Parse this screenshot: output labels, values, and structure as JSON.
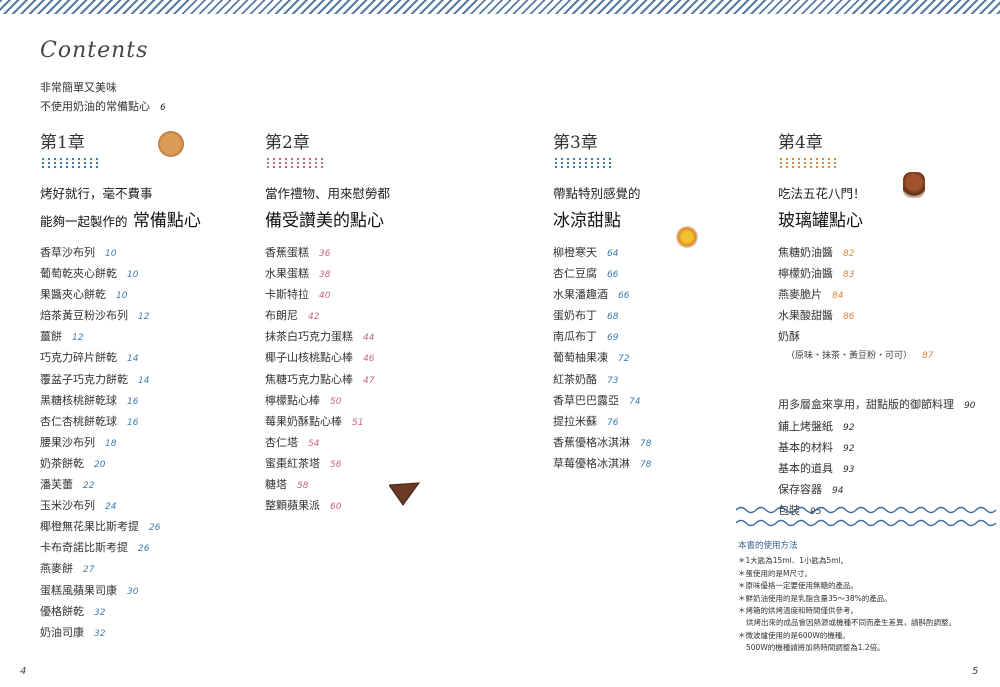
{
  "contents_title": "Contents",
  "intro": {
    "line1": "非常簡單又美味",
    "line2": "不使用奶油的常備點心",
    "page": "6"
  },
  "colors": {
    "blue": "#3e7bb0",
    "pink": "#c8648c",
    "orange": "#d98a3e",
    "wave": "#3f6e9e"
  },
  "chapters": [
    {
      "label": "第1章",
      "sub1": "烤好就行，毫不費事",
      "sub2a": "能夠一起製作的",
      "sub2b": "常備點心",
      "items": [
        {
          "t": "香草沙布列",
          "p": "10"
        },
        {
          "t": "葡萄乾夾心餅乾",
          "p": "10"
        },
        {
          "t": "果醬夾心餅乾",
          "p": "10"
        },
        {
          "t": "焙茶黃豆粉沙布列",
          "p": "12"
        },
        {
          "t": "薑餅",
          "p": "12"
        },
        {
          "t": "巧克力碎片餅乾",
          "p": "14"
        },
        {
          "t": "覆盆子巧克力餅乾",
          "p": "14"
        },
        {
          "t": "黑糖核桃餅乾球",
          "p": "16"
        },
        {
          "t": "杏仁杏桃餅乾球",
          "p": "16"
        },
        {
          "t": "腰果沙布列",
          "p": "18"
        },
        {
          "t": "奶茶餅乾",
          "p": "20"
        },
        {
          "t": "潘芙蕾",
          "p": "22"
        },
        {
          "t": "玉米沙布列",
          "p": "24"
        },
        {
          "t": "椰橙無花果比斯考提",
          "p": "26"
        },
        {
          "t": "卡布奇諾比斯考提",
          "p": "26"
        },
        {
          "t": "燕麥餅",
          "p": "27"
        },
        {
          "t": "蛋糕風蘋果司康",
          "p": "30"
        },
        {
          "t": "優格餅乾",
          "p": "32"
        },
        {
          "t": "奶油司康",
          "p": "32"
        }
      ]
    },
    {
      "label": "第2章",
      "sub1": "當作禮物、用來慰勞都",
      "sub2a": "備受讚美的點心",
      "sub2b": "",
      "items": [
        {
          "t": "香蕉蛋糕",
          "p": "36"
        },
        {
          "t": "水果蛋糕",
          "p": "38"
        },
        {
          "t": "卡斯特拉",
          "p": "40"
        },
        {
          "t": "布朗尼",
          "p": "42"
        },
        {
          "t": "抹茶白巧克力蛋糕",
          "p": "44"
        },
        {
          "t": "椰子山核桃點心棒",
          "p": "46"
        },
        {
          "t": "焦糖巧克力點心棒",
          "p": "47"
        },
        {
          "t": "檸檬點心棒",
          "p": "50"
        },
        {
          "t": "莓果奶酥點心棒",
          "p": "51"
        },
        {
          "t": "杏仁塔",
          "p": "54"
        },
        {
          "t": "蜜棗紅茶塔",
          "p": "56"
        },
        {
          "t": "糖塔",
          "p": "58"
        },
        {
          "t": "整顆蘋果派",
          "p": "60"
        }
      ]
    },
    {
      "label": "第3章",
      "sub1": "帶點特別感覺的",
      "sub2a": "冰涼甜點",
      "sub2b": "",
      "items": [
        {
          "t": "柳橙寒天",
          "p": "64"
        },
        {
          "t": "杏仁豆腐",
          "p": "66"
        },
        {
          "t": "水果潘趣酒",
          "p": "66"
        },
        {
          "t": "蛋奶布丁",
          "p": "68"
        },
        {
          "t": "南瓜布丁",
          "p": "69"
        },
        {
          "t": "葡萄柚果凍",
          "p": "72"
        },
        {
          "t": "紅茶奶酪",
          "p": "73"
        },
        {
          "t": "香草巴巴露亞",
          "p": "74"
        },
        {
          "t": "提拉米蘇",
          "p": "76"
        },
        {
          "t": "香蕉優格冰淇淋",
          "p": "78"
        },
        {
          "t": "草莓優格冰淇淋",
          "p": "78"
        }
      ]
    },
    {
      "label": "第4章",
      "sub1": "吃法五花八門！",
      "sub2a": "玻璃罐點心",
      "sub2b": "",
      "items": [
        {
          "t": "焦糖奶油醬",
          "p": "82"
        },
        {
          "t": "檸檬奶油醬",
          "p": "83"
        },
        {
          "t": "燕麥脆片",
          "p": "84"
        },
        {
          "t": "水果酸甜醬",
          "p": "86"
        },
        {
          "t": "奶酥",
          "p": ""
        }
      ],
      "crumble_variants": {
        "t": "（原味・抹茶・黃豆粉・可可）",
        "p": "87"
      },
      "extras": [
        {
          "t": "用多層盒來享用，甜點版的御節料理",
          "p": "90"
        },
        {
          "t": "鋪上烤盤紙",
          "p": "92"
        },
        {
          "t": "基本的材料",
          "p": "92"
        },
        {
          "t": "基本的道具",
          "p": "93"
        },
        {
          "t": "保存容器",
          "p": "94"
        },
        {
          "t": "包裝",
          "p": "95"
        }
      ]
    }
  ],
  "usage": {
    "title": "本書的使用方法",
    "lines": [
      "＊1大匙為15ml、1小匙為5ml。",
      "＊蛋使用的是M尺寸。",
      "＊原味優格一定要使用無糖的產品。",
      "＊鮮奶油使用的是乳脂含量35～38%的產品。",
      "＊烤箱的烘烤溫度和時間僅供參考。",
      "烘烤出來的成品會因熱源或機種不同而產生差異，請斟酌調整。",
      "＊微波爐使用的是600W的機種。",
      "500W的機種請將加熱時間調整為1.2倍。"
    ]
  },
  "page_left": "4",
  "page_right": "5"
}
